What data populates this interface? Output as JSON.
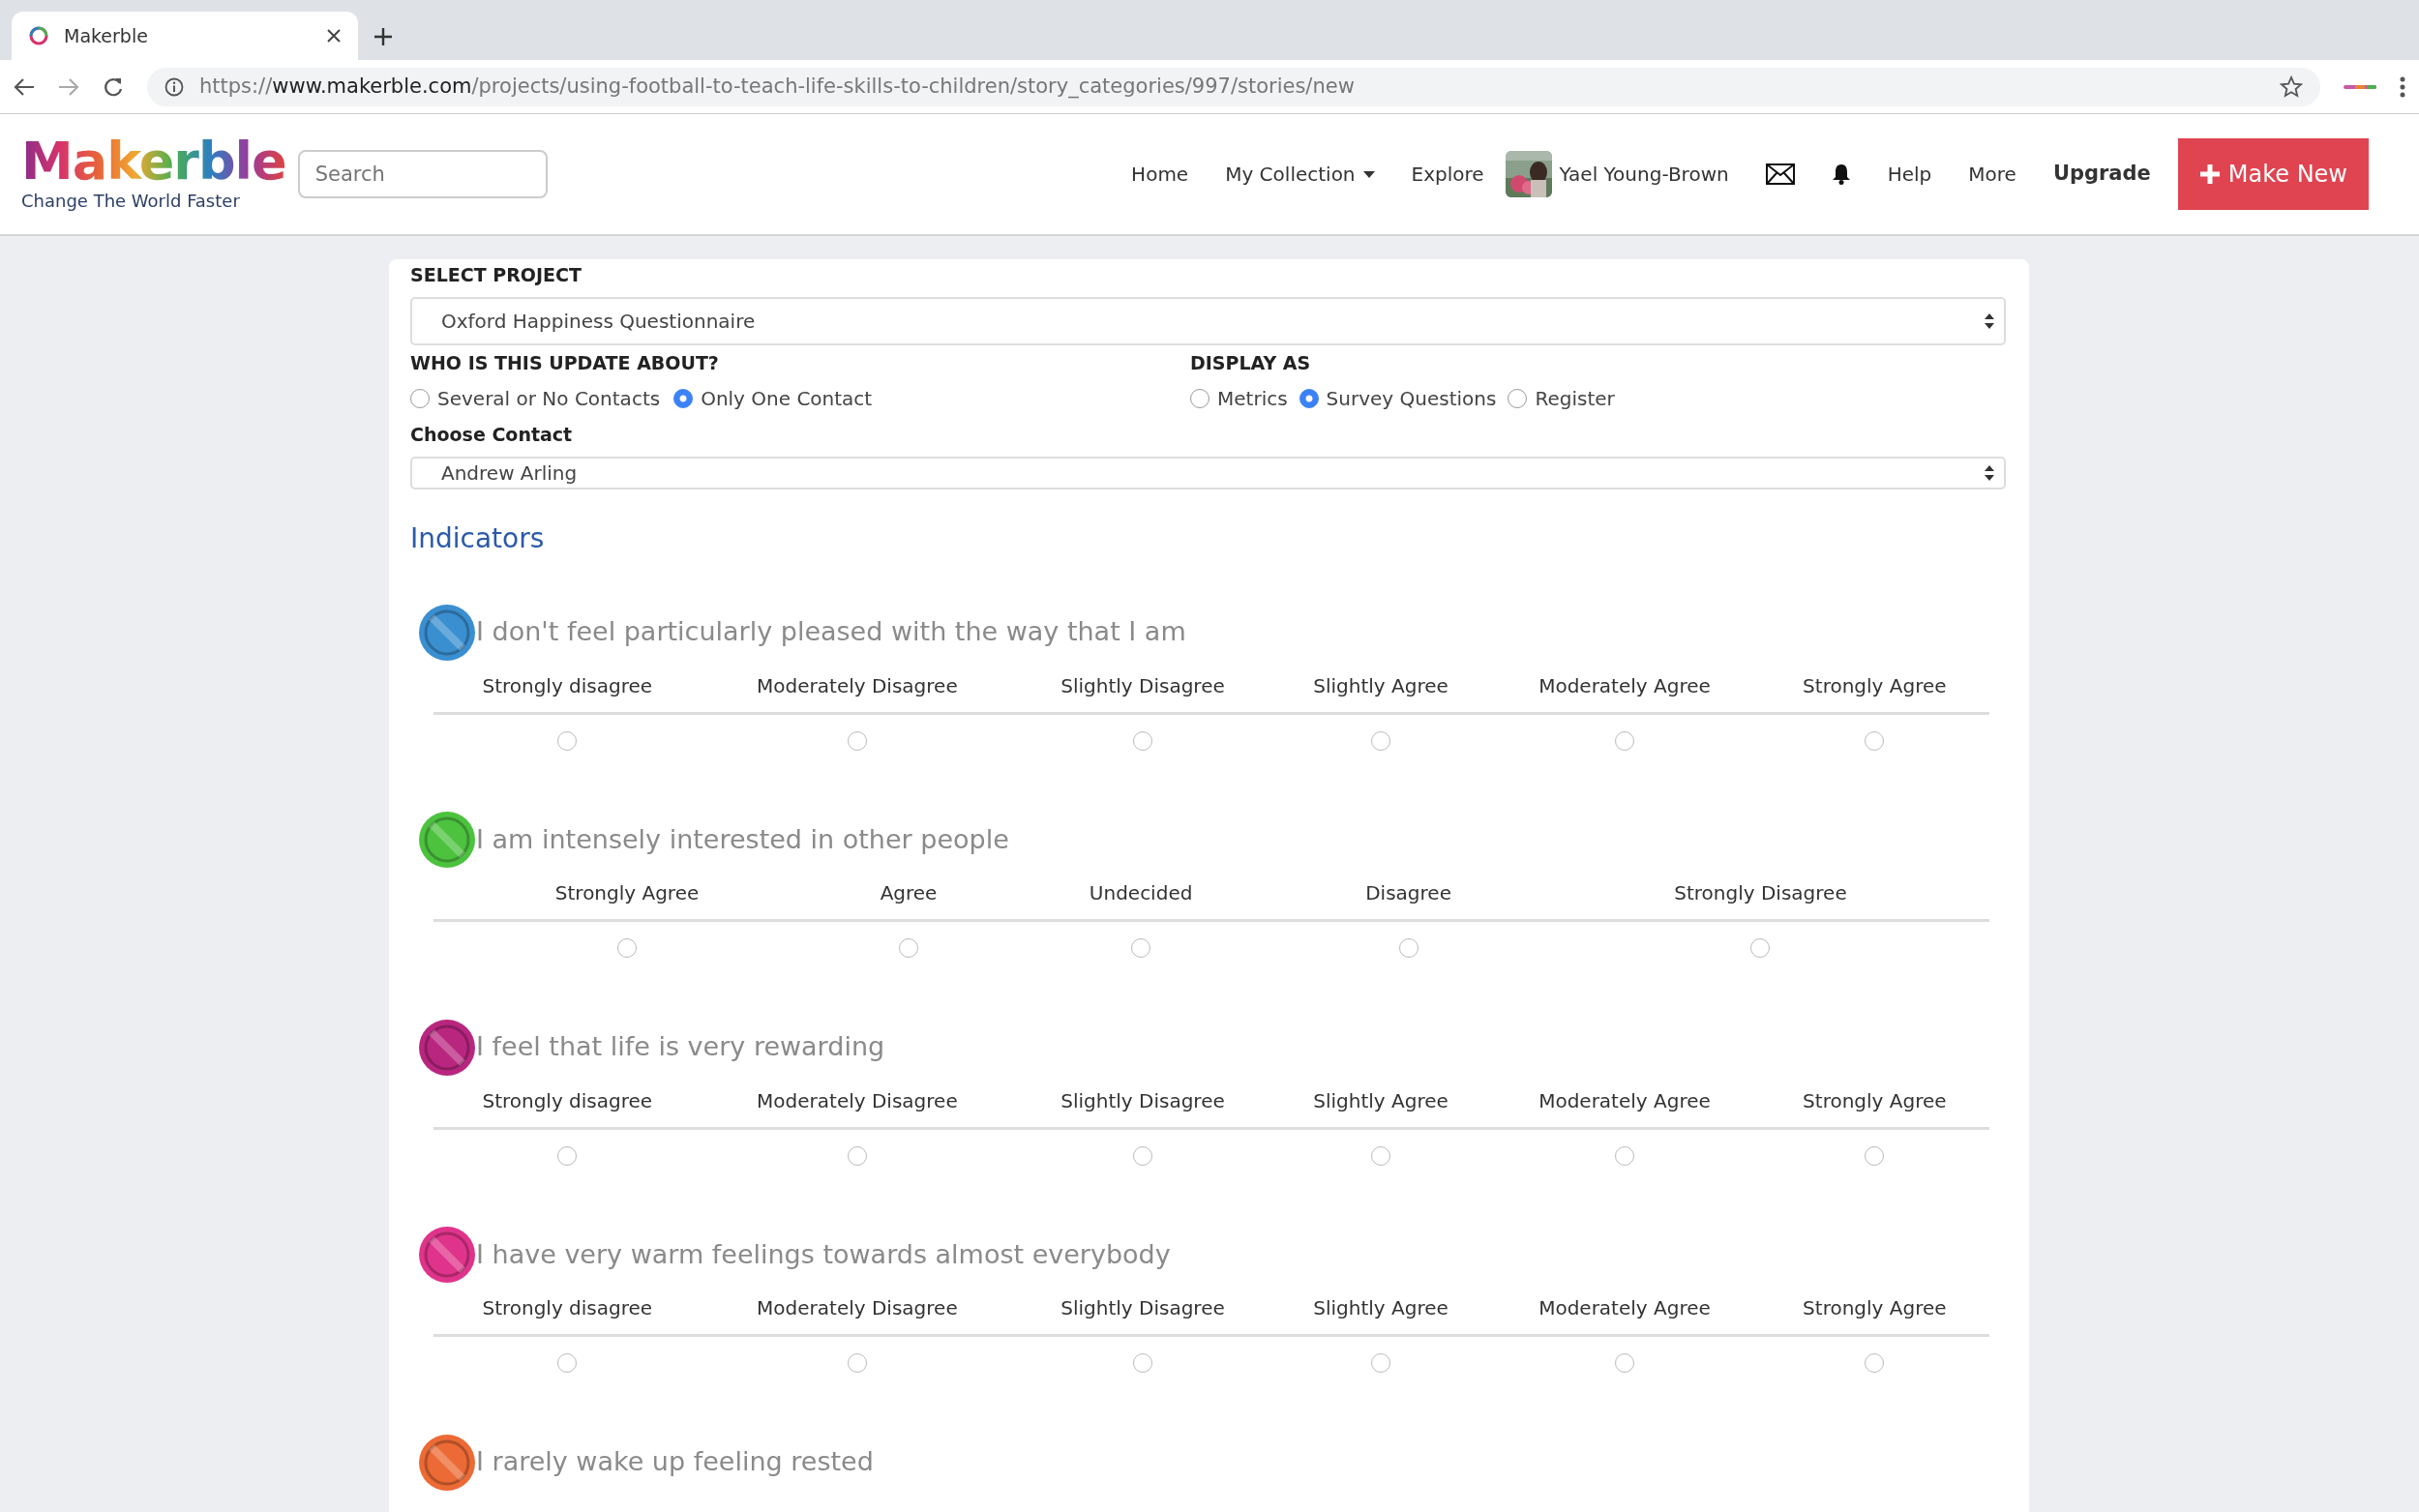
{
  "browser": {
    "tab_title": "Makerble",
    "url_scheme": "https://",
    "url_host": "www.makerble.com",
    "url_path": "/projects/using-football-to-teach-life-skills-to-children/story_categories/997/stories/new"
  },
  "navbar": {
    "logo": "Makerble",
    "tagline": "Change The World Faster",
    "search": {
      "placeholder": "Search"
    },
    "items": [
      {
        "kind": "link",
        "label": "Home"
      },
      {
        "kind": "dropdown",
        "label": "My Collection"
      },
      {
        "kind": "link",
        "label": "Explore"
      },
      {
        "kind": "user",
        "label": "Yael Young-Brown"
      },
      {
        "kind": "mail"
      },
      {
        "kind": "bell"
      },
      {
        "kind": "link",
        "label": "Help"
      },
      {
        "kind": "link",
        "label": "More"
      },
      {
        "kind": "strong",
        "label": "Upgrade"
      }
    ],
    "make_new": "Make New"
  },
  "form": {
    "project_label": "SELECT PROJECT",
    "project_value": "Oxford Happiness Questionnaire",
    "about_label": "WHO IS THIS UPDATE ABOUT?",
    "about_options": [
      {
        "label": "Several or No Contacts",
        "selected": false
      },
      {
        "label": "Only One Contact",
        "selected": true
      }
    ],
    "display_label": "DISPLAY AS",
    "display_options": [
      {
        "label": "Metrics",
        "selected": false
      },
      {
        "label": "Survey Questions",
        "selected": true
      },
      {
        "label": "Register",
        "selected": false
      }
    ],
    "contact_label": "Choose Contact",
    "contact_value": "Andrew Arling"
  },
  "indicators_title": "Indicators",
  "questions": [
    {
      "text": "I don't feel particularly pleased with the way that I am",
      "color": "#3a8fd0",
      "options": [
        {
          "label": "Strongly disagree",
          "selected": false
        },
        {
          "label": "Moderately Disagree",
          "selected": false
        },
        {
          "label": "Slightly Disagree",
          "selected": false
        },
        {
          "label": "Slightly Agree",
          "selected": false
        },
        {
          "label": "Moderately Agree",
          "selected": false
        },
        {
          "label": "Strongly Agree",
          "selected": false
        }
      ]
    },
    {
      "text": "I am intensely interested in other people",
      "color": "#4cc23f",
      "options": [
        {
          "label": "Strongly Agree",
          "selected": false
        },
        {
          "label": "Agree",
          "selected": false
        },
        {
          "label": "Undecided",
          "selected": false
        },
        {
          "label": "Disagree",
          "selected": false
        },
        {
          "label": "Strongly Disagree",
          "selected": false
        }
      ]
    },
    {
      "text": "I feel that life is very rewarding",
      "color": "#b8267f",
      "options": [
        {
          "label": "Strongly disagree",
          "selected": false
        },
        {
          "label": "Moderately Disagree",
          "selected": false
        },
        {
          "label": "Slightly Disagree",
          "selected": false
        },
        {
          "label": "Slightly Agree",
          "selected": false
        },
        {
          "label": "Moderately Agree",
          "selected": false
        },
        {
          "label": "Strongly Agree",
          "selected": false
        }
      ]
    },
    {
      "text": "I have very warm feelings towards almost everybody",
      "color": "#e0338b",
      "options": [
        {
          "label": "Strongly disagree",
          "selected": false
        },
        {
          "label": "Moderately Disagree",
          "selected": false
        },
        {
          "label": "Slightly Disagree",
          "selected": false
        },
        {
          "label": "Slightly Agree",
          "selected": false
        },
        {
          "label": "Moderately Agree",
          "selected": false
        },
        {
          "label": "Strongly Agree",
          "selected": false
        }
      ]
    },
    {
      "text": "I rarely wake up feeling rested",
      "color": "#ec6a35"
    }
  ]
}
